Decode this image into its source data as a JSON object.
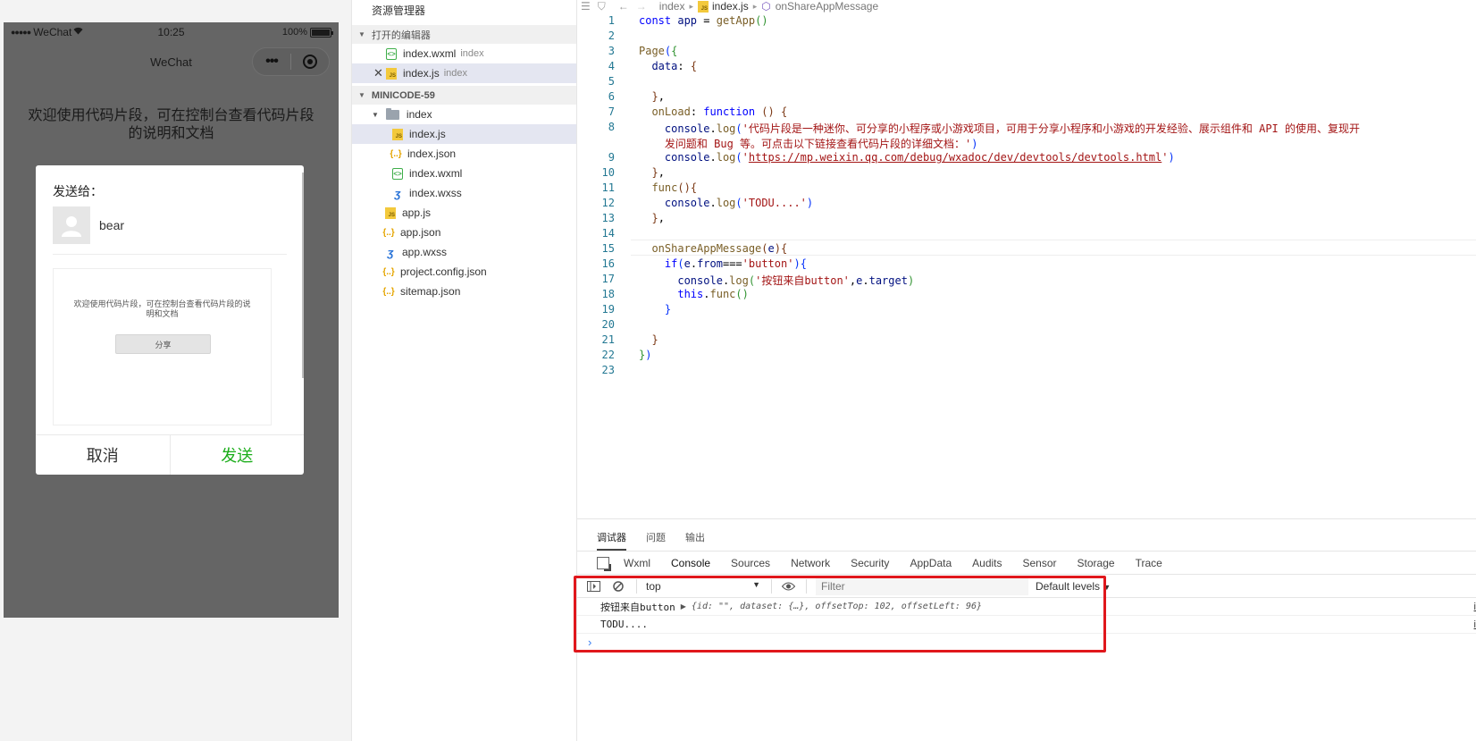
{
  "simulator": {
    "status": {
      "carrier": "WeChat",
      "time": "10:25",
      "battery": "100%"
    },
    "nav_title": "WeChat",
    "page_text": "欢迎使用代码片段，可在控制台查看代码片段的说明和文档",
    "share_dialog": {
      "send_to_label": "发送给：",
      "contact_name": "bear",
      "preview_text": "欢迎使用代码片段，可在控制台查看代码片段的说明和文档",
      "preview_button": "分享",
      "cancel_label": "取消",
      "send_label": "发送"
    }
  },
  "explorer": {
    "title": "资源管理器",
    "open_editors_label": "打开的编辑器",
    "open_editors": [
      {
        "name": "index.wxml",
        "hint": "index",
        "type": "wxml"
      },
      {
        "name": "index.js",
        "hint": "index",
        "type": "js"
      }
    ],
    "project_label": "MINICODE-59",
    "folder": "index",
    "folder_files": [
      {
        "name": "index.js",
        "type": "js"
      },
      {
        "name": "index.json",
        "type": "json"
      },
      {
        "name": "index.wxml",
        "type": "wxml"
      },
      {
        "name": "index.wxss",
        "type": "wxss"
      }
    ],
    "root_files": [
      {
        "name": "app.js",
        "type": "js"
      },
      {
        "name": "app.json",
        "type": "json"
      },
      {
        "name": "app.wxss",
        "type": "wxss"
      },
      {
        "name": "project.config.json",
        "type": "json"
      },
      {
        "name": "sitemap.json",
        "type": "json"
      }
    ]
  },
  "editor": {
    "breadcrumb": [
      "index",
      "index.js",
      "onShareAppMessage"
    ],
    "line_numbers": [
      "1",
      "2",
      "3",
      "4",
      "5",
      "6",
      "7",
      "8",
      "",
      "9",
      "10",
      "11",
      "12",
      "13",
      "14",
      "15",
      "16",
      "17",
      "18",
      "19",
      "20",
      "21",
      "22",
      "23"
    ]
  },
  "panel": {
    "tabs": [
      "调试器",
      "问题",
      "输出"
    ],
    "devtools_tabs": [
      "Wxml",
      "Console",
      "Sources",
      "Network",
      "Security",
      "AppData",
      "Audits",
      "Sensor",
      "Storage",
      "Trace"
    ],
    "context": "top",
    "filter_placeholder": "Filter",
    "levels": "Default levels",
    "logs": [
      {
        "message": "按钮来自button",
        "object": "{id: \"\", dataset: {…}, offsetTop: 102, offsetLeft: 96}",
        "source": "i"
      },
      {
        "message": "TODU....",
        "object": "",
        "source": "i"
      }
    ]
  },
  "colors": {
    "highlight": "#e0171c",
    "send_green": "#1aad19"
  }
}
